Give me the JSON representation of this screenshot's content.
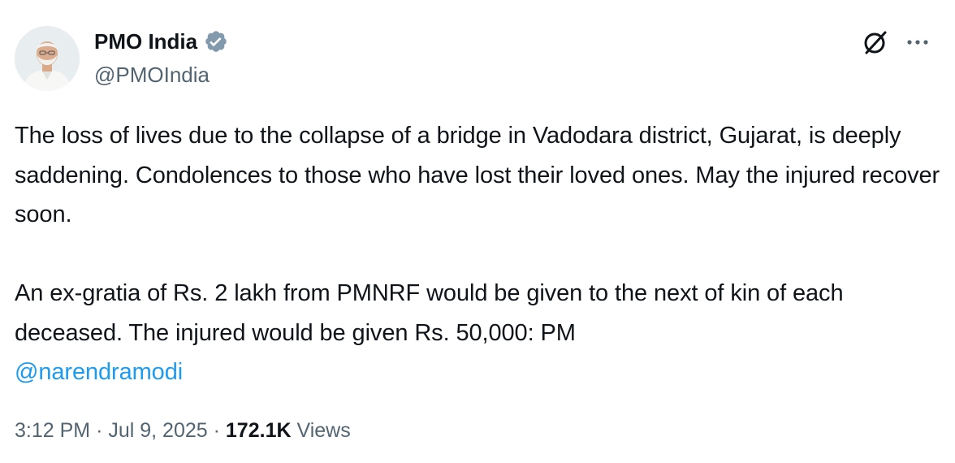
{
  "author": {
    "display_name": "PMO India",
    "handle": "@PMOIndia",
    "verified": true,
    "verified_color": "#829aab"
  },
  "icons": {
    "verified": "verified-badge-icon",
    "grok": "grok-icon",
    "more": "more-options-icon"
  },
  "tweet": {
    "paragraph_1": "The loss of lives due to the collapse of a bridge in Vadodara district, Gujarat, is deeply saddening. Condolences to those who have lost their loved ones. May the injured recover soon.",
    "paragraph_2_text": "An ex-gratia of Rs. 2 lakh from PMNRF would be given to the next of kin of each deceased. The injured would be given Rs. 50,000: PM",
    "mention": "@narendramodi"
  },
  "meta": {
    "time": "3:12 PM",
    "separator": "·",
    "date": "Jul 9, 2025",
    "views_count": "172.1K",
    "views_label": "Views"
  },
  "colors": {
    "text_primary": "#0f1419",
    "text_secondary": "#536471",
    "link": "#1d9bf0"
  }
}
